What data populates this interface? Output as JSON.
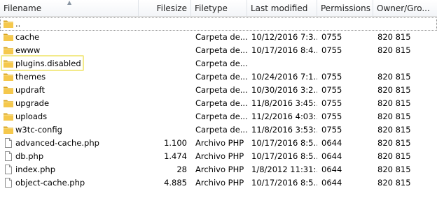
{
  "columns": [
    {
      "key": "filename",
      "label": "Filename"
    },
    {
      "key": "filesize",
      "label": "Filesize"
    },
    {
      "key": "filetype",
      "label": "Filetype"
    },
    {
      "key": "modified",
      "label": "Last modified"
    },
    {
      "key": "permissions",
      "label": "Permissions"
    },
    {
      "key": "owner",
      "label": "Owner/Gro..."
    }
  ],
  "sort": {
    "column": "filename",
    "direction": "ascending"
  },
  "rows": [
    {
      "name": "..",
      "icon": "folder-icon",
      "size": "",
      "type": "",
      "modified": "",
      "perms": "",
      "owner": ""
    },
    {
      "name": "cache",
      "icon": "folder-icon",
      "size": "",
      "type": "Carpeta de...",
      "modified": "10/12/2016 7:3...",
      "perms": "0755",
      "owner": "820 815"
    },
    {
      "name": "ewww",
      "icon": "folder-icon",
      "size": "",
      "type": "Carpeta de...",
      "modified": "10/17/2016 8:4...",
      "perms": "0755",
      "owner": "820 815"
    },
    {
      "name": "plugins.disabled",
      "icon": "folder-icon",
      "size": "",
      "type": "Carpeta de...",
      "modified": "",
      "perms": "",
      "owner": ""
    },
    {
      "name": "themes",
      "icon": "folder-icon",
      "size": "",
      "type": "Carpeta de...",
      "modified": "10/24/2016 7:1...",
      "perms": "0755",
      "owner": "820 815"
    },
    {
      "name": "updraft",
      "icon": "folder-icon",
      "size": "",
      "type": "Carpeta de...",
      "modified": "10/30/2016 3:2...",
      "perms": "0755",
      "owner": "820 815"
    },
    {
      "name": "upgrade",
      "icon": "folder-icon",
      "size": "",
      "type": "Carpeta de...",
      "modified": "11/8/2016 3:45:...",
      "perms": "0755",
      "owner": "820 815"
    },
    {
      "name": "uploads",
      "icon": "folder-icon",
      "size": "",
      "type": "Carpeta de...",
      "modified": "11/2/2016 4:03:...",
      "perms": "0755",
      "owner": "820 815"
    },
    {
      "name": "w3tc-config",
      "icon": "folder-icon",
      "size": "",
      "type": "Carpeta de...",
      "modified": "11/8/2016 3:53:...",
      "perms": "0755",
      "owner": "820 815"
    },
    {
      "name": "advanced-cache.php",
      "icon": "file-icon",
      "size": "1.100",
      "type": "Archivo PHP",
      "modified": "10/17/2016 8:5...",
      "perms": "0644",
      "owner": "820 815"
    },
    {
      "name": "db.php",
      "icon": "file-icon",
      "size": "1.474",
      "type": "Archivo PHP",
      "modified": "10/17/2016 8:5...",
      "perms": "0644",
      "owner": "820 815"
    },
    {
      "name": "index.php",
      "icon": "file-icon",
      "size": "28",
      "type": "Archivo PHP",
      "modified": "1/8/2012 11:31:...",
      "perms": "0644",
      "owner": "820 815"
    },
    {
      "name": "object-cache.php",
      "icon": "file-icon",
      "size": "4.885",
      "type": "Archivo PHP",
      "modified": "10/17/2016 8:5...",
      "perms": "0644",
      "owner": "820 815"
    }
  ],
  "highlighted_row": "plugins.disabled",
  "colors": {
    "folder": "#f5c84c",
    "folder_dark": "#d9a520",
    "highlight_border": "#f3ea8a",
    "header_text": "#1e1e1e"
  }
}
